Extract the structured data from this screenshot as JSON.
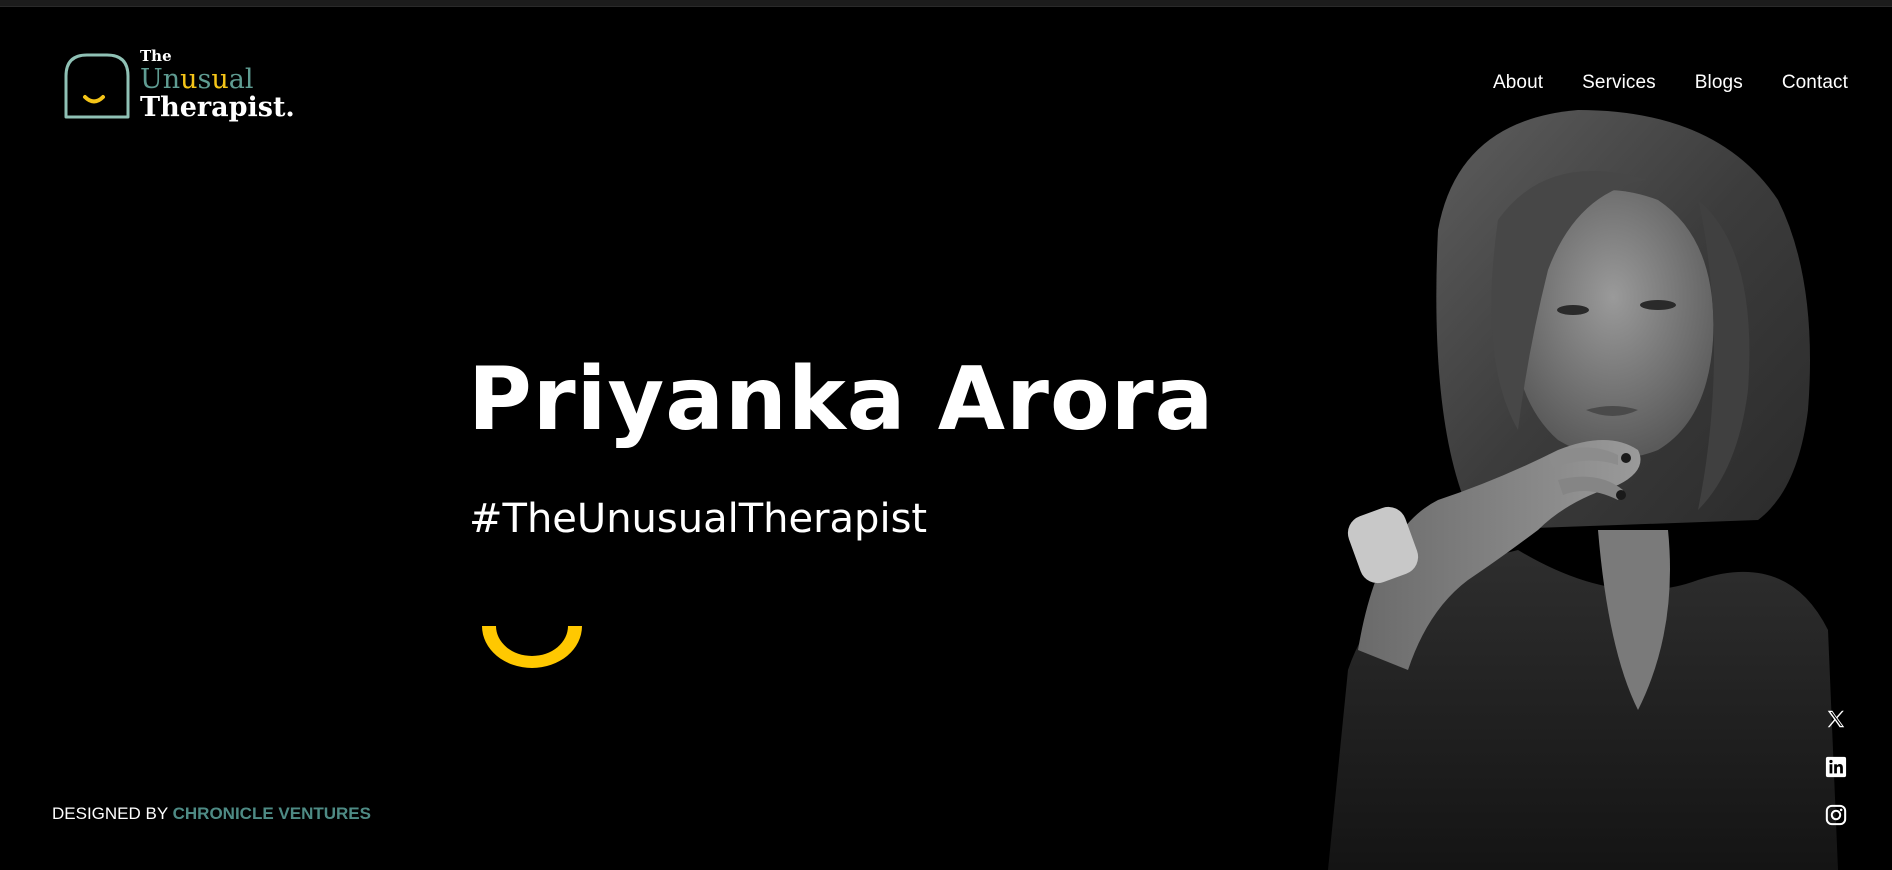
{
  "logo": {
    "line1": "The",
    "line2": "Unusual",
    "line3": "Therapist.",
    "accent_color": "#f5c518",
    "brand_teal": "#5f9c92"
  },
  "nav": {
    "items": [
      {
        "label": "About"
      },
      {
        "label": "Services"
      },
      {
        "label": "Blogs"
      },
      {
        "label": "Contact"
      }
    ]
  },
  "hero": {
    "name": "Priyanka Arora",
    "tagline": "#TheUnusualTherapist",
    "smile_color": "#ffc800",
    "portrait": "grayscale-portrait-photo"
  },
  "footer": {
    "designed_by_prefix": "DESIGNED BY",
    "designer_name": "CHRONICLE VENTURES",
    "designer_color": "#4e8b85"
  },
  "social": [
    {
      "icon": "x-twitter-icon"
    },
    {
      "icon": "linkedin-icon"
    },
    {
      "icon": "instagram-icon"
    }
  ]
}
